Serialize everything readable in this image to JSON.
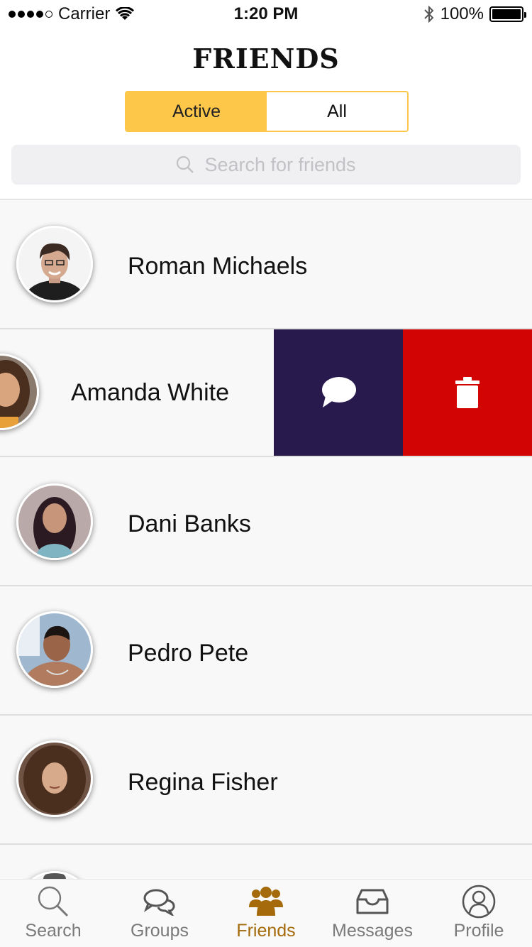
{
  "status_bar": {
    "carrier": "Carrier",
    "time": "1:20 PM",
    "battery": "100%"
  },
  "header": {
    "title": "FRIENDS"
  },
  "segmented": {
    "active_label": "Active",
    "all_label": "All",
    "selected": "Active"
  },
  "search": {
    "placeholder": "Search for friends"
  },
  "friends": [
    {
      "name": "Roman Michaels"
    },
    {
      "name": "Amanda White"
    },
    {
      "name": "Dani Banks"
    },
    {
      "name": "Pedro Pete"
    },
    {
      "name": "Regina Fisher"
    }
  ],
  "swipe_actions": {
    "message_icon": "speech-bubble-icon",
    "delete_icon": "trash-icon"
  },
  "tab_bar": {
    "tabs": [
      {
        "label": "Search",
        "icon": "magnifier-icon"
      },
      {
        "label": "Groups",
        "icon": "chat-bubbles-icon"
      },
      {
        "label": "Friends",
        "icon": "people-icon",
        "selected": true
      },
      {
        "label": "Messages",
        "icon": "inbox-icon"
      },
      {
        "label": "Profile",
        "icon": "user-icon"
      }
    ]
  },
  "colors": {
    "accent_yellow": "#fdc74a",
    "message_action": "#291a4e",
    "delete_action": "#d20404",
    "tab_selected": "#a56a0c"
  }
}
